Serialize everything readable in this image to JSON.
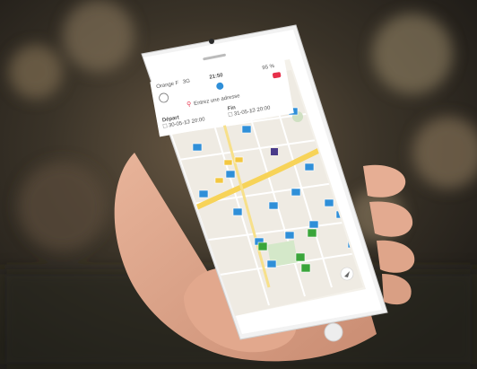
{
  "status_bar": {
    "carrier": "Orange F",
    "network": "3G",
    "time": "21:50",
    "battery": "95 %"
  },
  "search": {
    "placeholder": "Entrez une adresse"
  },
  "filters": {
    "depart_label": "Départ",
    "depart_date": "30-05-17",
    "depart_time": "20:00",
    "fin_label": "Fin",
    "fin_date": "31-05-17",
    "fin_time": "20:00"
  },
  "map": {
    "pin_icon": "parking-pin-icon",
    "locate_icon": "locate-arrow-icon"
  },
  "colors": {
    "pin_blue": "#2f8fd8",
    "pin_green": "#3aa53a",
    "road_yellow": "#f7d358",
    "accent_red": "#e7304a"
  }
}
